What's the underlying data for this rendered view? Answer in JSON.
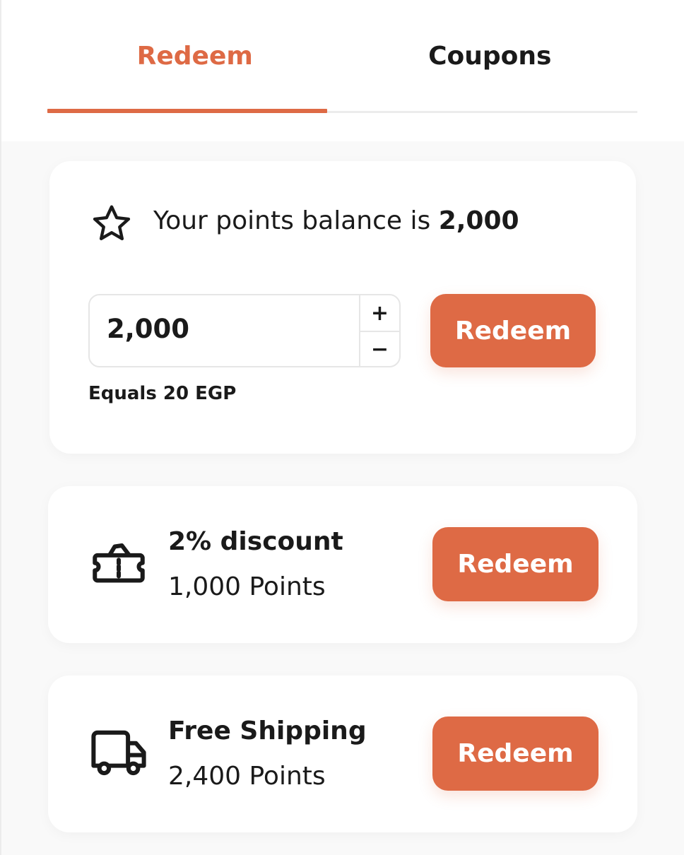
{
  "colors": {
    "accent": "#de6a45",
    "text": "#1a1a1a",
    "background": "#f9f9f9",
    "card": "#ffffff",
    "border": "#e6e6e6"
  },
  "tabs": [
    {
      "label": "Redeem",
      "active": true
    },
    {
      "label": "Coupons",
      "active": false
    }
  ],
  "balance": {
    "icon": "star-icon",
    "prefix": "Your points balance is ",
    "amount": "2,000",
    "input_value": "2,000",
    "increment_symbol": "+",
    "decrement_symbol": "−",
    "equals_text": "Equals 20 EGP",
    "button_label": "Redeem"
  },
  "offers": [
    {
      "icon": "coupon-ticket-icon",
      "title": "2% discount",
      "points": "1,000 Points",
      "button_label": "Redeem"
    },
    {
      "icon": "delivery-truck-icon",
      "title": "Free Shipping",
      "points": "2,400 Points",
      "button_label": "Redeem"
    }
  ]
}
